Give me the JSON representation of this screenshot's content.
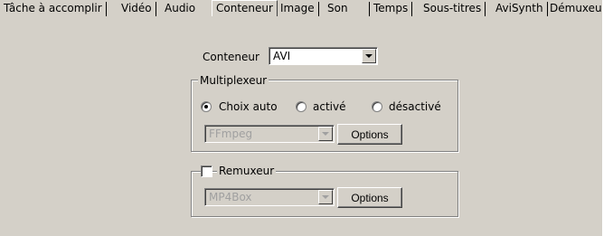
{
  "tabs": [
    {
      "label": "Tâche à accomplir"
    },
    {
      "label": "Vidéo"
    },
    {
      "label": "Audio"
    },
    {
      "label": "Conteneur"
    },
    {
      "label": "Image"
    },
    {
      "label": "Son"
    },
    {
      "label": "Temps"
    },
    {
      "label": "Sous-titres"
    },
    {
      "label": "AviSynth"
    },
    {
      "label": "Démuxeur"
    }
  ],
  "container": {
    "label": "Conteneur",
    "value": "AVI"
  },
  "multiplexer": {
    "title": "Multiplexeur",
    "options": [
      "Choix auto",
      "activé",
      "désactivé"
    ],
    "selected": "Choix auto",
    "engine": "FFmpeg",
    "options_button": "Options"
  },
  "remuxer": {
    "title": "Remuxeur",
    "checked": false,
    "engine": "MP4Box",
    "options_button": "Options"
  }
}
